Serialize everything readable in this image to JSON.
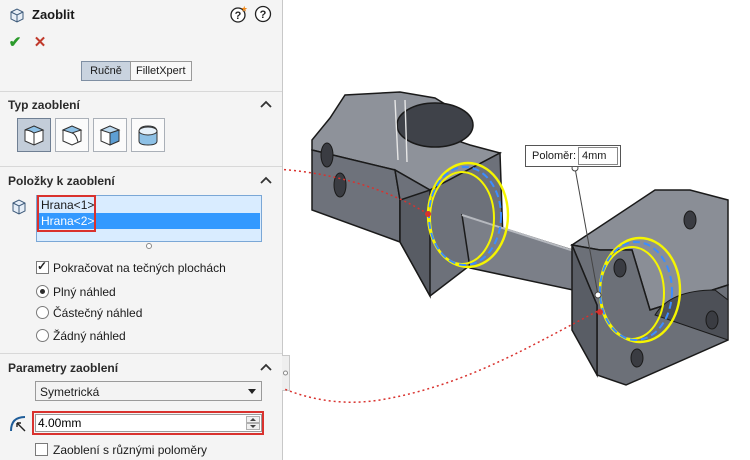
{
  "panel": {
    "title": "Zaoblit",
    "tabs": [
      {
        "label": "Ručně",
        "active": true
      },
      {
        "label": "FilletXpert",
        "active": false
      }
    ],
    "sections": {
      "fillet_type": {
        "title": "Typ zaoblení",
        "buttons": [
          {
            "icon": "constant-size-fillet-icon",
            "active": true
          },
          {
            "icon": "variable-size-fillet-icon",
            "active": false
          },
          {
            "icon": "face-fillet-icon",
            "active": false
          },
          {
            "icon": "full-round-fillet-icon",
            "active": false
          }
        ]
      },
      "items": {
        "title": "Položky k zaoblení",
        "list": [
          "Hrana<1>",
          "Hrana<2>"
        ],
        "selected_index": 1,
        "tangent_propagation": {
          "label": "Pokračovat na tečných plochách",
          "checked": true
        },
        "preview_options": [
          {
            "label": "Plný náhled",
            "selected": true
          },
          {
            "label": "Částečný náhled",
            "selected": false
          },
          {
            "label": "Žádný náhled",
            "selected": false
          }
        ]
      },
      "params": {
        "title": "Parametry zaoblení",
        "method": "Symetrická",
        "radius": "4.00mm",
        "multi_radius": {
          "label": "Zaoblení s různými poloměry",
          "checked": false
        }
      }
    }
  },
  "viewport": {
    "callout": {
      "label": "Poloměr:",
      "value": "4mm"
    }
  },
  "colors": {
    "accent": "#3399ff",
    "highlight": "#d9322e",
    "preview": "#f5f500",
    "preview_dash": "#3c8dff",
    "part": "#5f636d"
  }
}
